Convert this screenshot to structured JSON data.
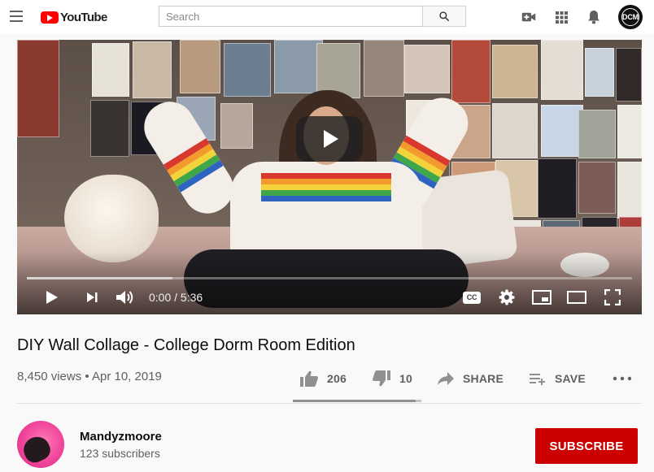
{
  "masthead": {
    "logo_text": "YouTube",
    "search_placeholder": "Search",
    "icons": [
      "menu-icon",
      "search-icon",
      "create-video-icon",
      "apps-grid-icon",
      "notifications-bell-icon"
    ],
    "account_initials": "DCM"
  },
  "player": {
    "current_time": "0:00",
    "duration": "5:36",
    "time_separator": " / ",
    "progress_fraction": 0.0,
    "buffered_fraction": 0.24,
    "controls": [
      "play-icon",
      "next-icon",
      "volume-icon",
      "captions-icon",
      "settings-gear-icon",
      "miniplayer-icon",
      "theater-mode-icon",
      "fullscreen-icon"
    ],
    "cc_label": "CC"
  },
  "video": {
    "title": "DIY Wall Collage - College Dorm Room Edition",
    "views": "8,450 views",
    "date_separator": " • ",
    "upload_date": "Apr 10, 2019"
  },
  "actions": {
    "likes": "206",
    "dislikes": "10",
    "share_label": "SHARE",
    "save_label": "SAVE",
    "like_fraction": 0.954
  },
  "channel": {
    "name": "Mandyzmoore",
    "subscribers": "123 subscribers",
    "subscribe_label": "SUBSCRIBE"
  },
  "colors": {
    "brand_red": "#ff0000",
    "subscribe_red": "#cc0000",
    "icon_gray": "#606060",
    "background": "#f9f9f9"
  }
}
